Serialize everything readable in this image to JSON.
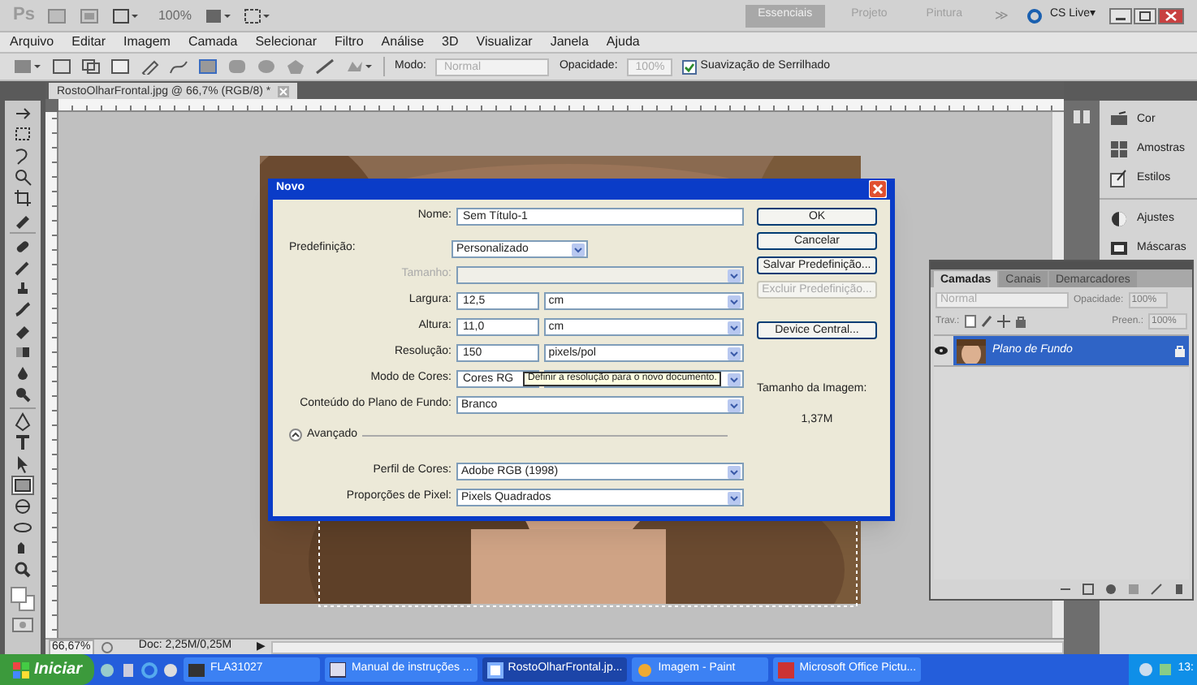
{
  "app_bar": {
    "logo": "Ps",
    "zoom": "100%",
    "workspaces": [
      {
        "label": "Essenciais",
        "selected": true
      },
      {
        "label": "Projeto",
        "selected": false
      },
      {
        "label": "Pintura",
        "selected": false
      }
    ],
    "more": "≫",
    "cs_live": "CS Live▾"
  },
  "menu": [
    "Arquivo",
    "Editar",
    "Imagem",
    "Camada",
    "Selecionar",
    "Filtro",
    "Análise",
    "3D",
    "Visualizar",
    "Janela",
    "Ajuda"
  ],
  "options_bar": {
    "mode_label": "Modo:",
    "mode_value": "Normal",
    "opacity_label": "Opacidade:",
    "opacity_value": "100%",
    "antialias": {
      "label": "Suavização de Serrilhado",
      "checked": true
    }
  },
  "document": {
    "tab": "RostoOlharFrontal.jpg @ 66,7% (RGB/8) *",
    "zoom": "66,67%",
    "doc_size": "Doc: 2,25M/0,25M",
    "status_arrow": "▶"
  },
  "toolbox": {
    "tools": [
      {
        "selected": false
      },
      {
        "selected": false
      },
      {
        "selected": false
      },
      {
        "selected": false
      },
      {
        "selected": false
      },
      {
        "selected": false
      },
      {
        "selected": false
      },
      {
        "selected": false
      },
      {
        "selected": false
      },
      {
        "selected": false
      },
      {
        "selected": false
      },
      {
        "selected": false
      },
      {
        "selected": false
      },
      {
        "selected": false
      },
      {
        "selected": false
      },
      {
        "selected": false
      },
      {
        "selected": false
      },
      {
        "selected": true
      },
      {
        "selected": false
      },
      {
        "selected": false
      },
      {
        "selected": false
      },
      {
        "selected": false
      }
    ]
  },
  "dock": {
    "groups": [
      {
        "panels": [
          "Cor",
          "Amostras",
          "Estilos"
        ]
      },
      {
        "panels": [
          "Ajustes",
          "Máscaras"
        ]
      }
    ]
  },
  "layers_panel": {
    "tabs": [
      {
        "label": "Camadas",
        "selected": true
      },
      {
        "label": "Canais",
        "selected": false
      },
      {
        "label": "Demarcadores",
        "selected": false
      }
    ],
    "blend_mode": "Normal",
    "opacity_label": "Opacidade:",
    "opacity_value": "100%",
    "lock_label": "Trav.:",
    "fill_label": "Preen.:",
    "fill_value": "100%",
    "layers": [
      {
        "name": "Plano de Fundo",
        "visible": true,
        "selected": true,
        "locked": true
      }
    ]
  },
  "dialog": {
    "title": "Novo",
    "fields": [
      {
        "kind": "text",
        "label": "Nome:",
        "value": "Sem Título-1",
        "disabled": false
      },
      {
        "kind": "preset",
        "label": "Predefinição:",
        "value": "Personalizado",
        "disabled": false
      },
      {
        "kind": "select",
        "label": "Tamanho:",
        "disabled": true
      },
      {
        "kind": "measure",
        "label": "Largura:",
        "value": "12,5",
        "unit": "cm",
        "disabled": false
      },
      {
        "kind": "measure",
        "label": "Altura:",
        "value": "11,0",
        "unit": "cm",
        "disabled": false
      },
      {
        "kind": "measure",
        "label": "Resolução:",
        "value": "150",
        "unit": "pixels/pol",
        "disabled": false
      },
      {
        "kind": "measure",
        "label": "Modo de Cores:",
        "value": "Cores RG",
        "disabled": false
      },
      {
        "kind": "select",
        "label": "Conteúdo do Plano de Fundo:",
        "value": "Branco",
        "disabled": false
      }
    ],
    "advanced": {
      "label": "Avançado",
      "expanded": true
    },
    "advanced_fields": [
      {
        "kind": "select",
        "label": "Perfil de Cores:",
        "value": "Adobe RGB (1998)",
        "disabled": false
      },
      {
        "kind": "select",
        "label": "Proporções de Pixel:",
        "value": "Pixels Quadrados",
        "disabled": false
      }
    ],
    "buttons": [
      {
        "label": "OK",
        "disabled": false
      },
      {
        "label": "Cancelar",
        "disabled": false
      },
      {
        "label": "Salvar Predefinição...",
        "disabled": false
      },
      {
        "label": "Excluir Predefinição...",
        "disabled": true
      },
      {
        "label": "Device Central...",
        "disabled": false
      }
    ],
    "image_size_label": "Tamanho da Imagem:",
    "image_size_value": "1,37M",
    "tooltip": "Definir a resolução para o novo documento."
  },
  "taskbar": {
    "start": "Iniciar",
    "tasks": [
      {
        "label": "FLA31027",
        "selected": false
      },
      {
        "label": "Manual de instruções ...",
        "selected": false
      },
      {
        "label": "RostoOlharFrontal.jp...",
        "selected": true
      },
      {
        "label": "Imagem - Paint",
        "selected": false
      },
      {
        "label": "Microsoft Office Pictu...",
        "selected": false
      }
    ],
    "clock": "13:"
  }
}
